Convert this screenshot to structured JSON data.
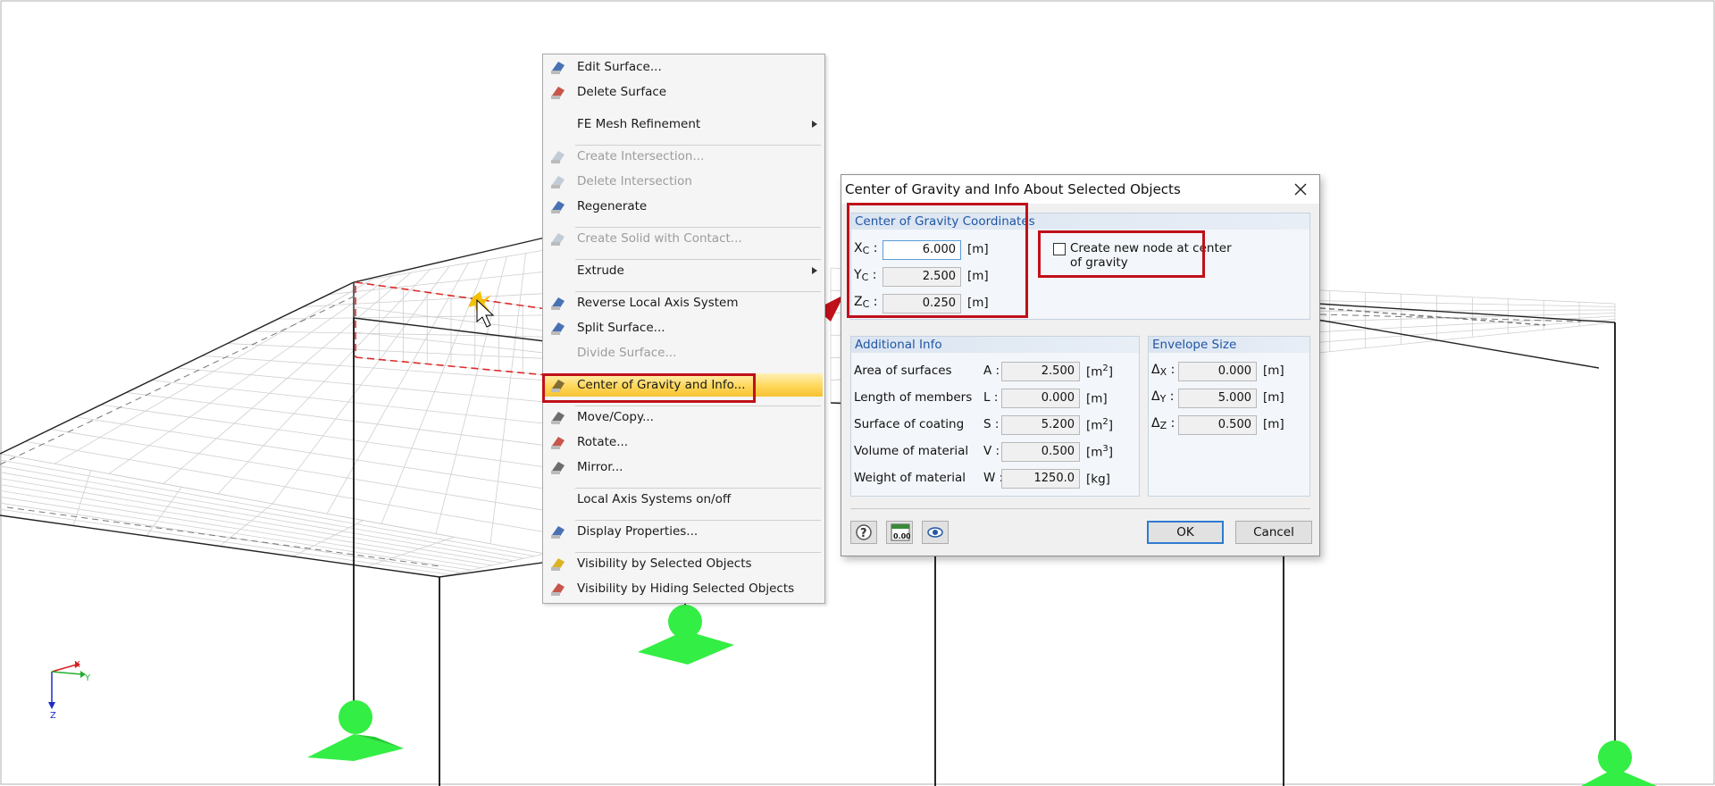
{
  "context_menu": {
    "items": [
      {
        "label": "Edit Surface...",
        "icon": "edit-surface-icon",
        "enabled": true
      },
      {
        "label": "Delete Surface",
        "icon": "delete-surface-icon",
        "enabled": true
      },
      {
        "label": "FE Mesh Refinement",
        "icon": "",
        "enabled": true,
        "submenu": true
      },
      {
        "label": "Create Intersection...",
        "icon": "create-intersection-icon",
        "enabled": false
      },
      {
        "label": "Delete Intersection",
        "icon": "delete-intersection-icon",
        "enabled": false
      },
      {
        "label": "Regenerate",
        "icon": "regenerate-icon",
        "enabled": true
      },
      {
        "label": "Create Solid with Contact...",
        "icon": "create-solid-icon",
        "enabled": false
      },
      {
        "label": "Extrude",
        "icon": "",
        "enabled": true,
        "submenu": true
      },
      {
        "label": "Reverse Local Axis System",
        "icon": "reverse-axis-icon",
        "enabled": true
      },
      {
        "label": "Split Surface...",
        "icon": "split-surface-icon",
        "enabled": true
      },
      {
        "label": "Divide Surface...",
        "icon": "",
        "enabled": false
      },
      {
        "label": "Center of Gravity and Info...",
        "icon": "balance-scale-icon",
        "enabled": true,
        "highlighted": true
      },
      {
        "label": "Move/Copy...",
        "icon": "move-copy-icon",
        "enabled": true
      },
      {
        "label": "Rotate...",
        "icon": "rotate-icon",
        "enabled": true
      },
      {
        "label": "Mirror...",
        "icon": "mirror-icon",
        "enabled": true
      },
      {
        "label": "Local Axis Systems on/off",
        "icon": "",
        "enabled": true
      },
      {
        "label": "Display Properties...",
        "icon": "display-properties-icon",
        "enabled": true
      },
      {
        "label": "Visibility by Selected Objects",
        "icon": "visibility-selected-icon",
        "enabled": true
      },
      {
        "label": "Visibility by Hiding Selected Objects",
        "icon": "visibility-hiding-icon",
        "enabled": true
      }
    ]
  },
  "dialog": {
    "title": "Center of Gravity and Info About Selected Objects",
    "cog_group": {
      "title": "Center of Gravity Coordinates",
      "rows": [
        {
          "axis": "X",
          "sub": "C",
          "value": "6.000",
          "unit": "[m]"
        },
        {
          "axis": "Y",
          "sub": "C",
          "value": "2.500",
          "unit": "[m]"
        },
        {
          "axis": "Z",
          "sub": "C",
          "value": "0.250",
          "unit": "[m]"
        }
      ]
    },
    "create_node": {
      "label_line1": "Create new node at center",
      "label_line2": "of gravity",
      "checked": false
    },
    "additional_info": {
      "title": "Additional Info",
      "rows": [
        {
          "label": "Area of surfaces",
          "symbol": "A :",
          "value": "2.500",
          "unit": "[m",
          "unit_sup": "2",
          "unit_end": "]"
        },
        {
          "label": "Length of members",
          "symbol": "L :",
          "value": "0.000",
          "unit": "[m]",
          "unit_sup": "",
          "unit_end": ""
        },
        {
          "label": "Surface of coating",
          "symbol": "S :",
          "value": "5.200",
          "unit": "[m",
          "unit_sup": "2",
          "unit_end": "]"
        },
        {
          "label": "Volume of material",
          "symbol": "V :",
          "value": "0.500",
          "unit": "[m",
          "unit_sup": "3",
          "unit_end": "]"
        },
        {
          "label": "Weight of material",
          "symbol": "W :",
          "value": "1250.0",
          "unit": "[kg]",
          "unit_sup": "",
          "unit_end": ""
        }
      ]
    },
    "envelope": {
      "title": "Envelope Size",
      "rows": [
        {
          "symbol": "Δ",
          "sub": "X",
          "value": "0.000",
          "unit": "[m]"
        },
        {
          "symbol": "Δ",
          "sub": "Y",
          "value": "5.000",
          "unit": "[m]"
        },
        {
          "symbol": "Δ",
          "sub": "Z",
          "value": "0.500",
          "unit": "[m]"
        }
      ]
    },
    "ok_label": "OK",
    "cancel_label": "Cancel",
    "footer_icons": [
      "help-icon",
      "units-icon",
      "view-icon"
    ],
    "units_icon_text": "0.00"
  },
  "viewport": {
    "axis_labels": {
      "x": "X",
      "y": "Y",
      "z": "Z"
    },
    "support_color": "#33ee44",
    "highlight_color": "#c0101a"
  }
}
